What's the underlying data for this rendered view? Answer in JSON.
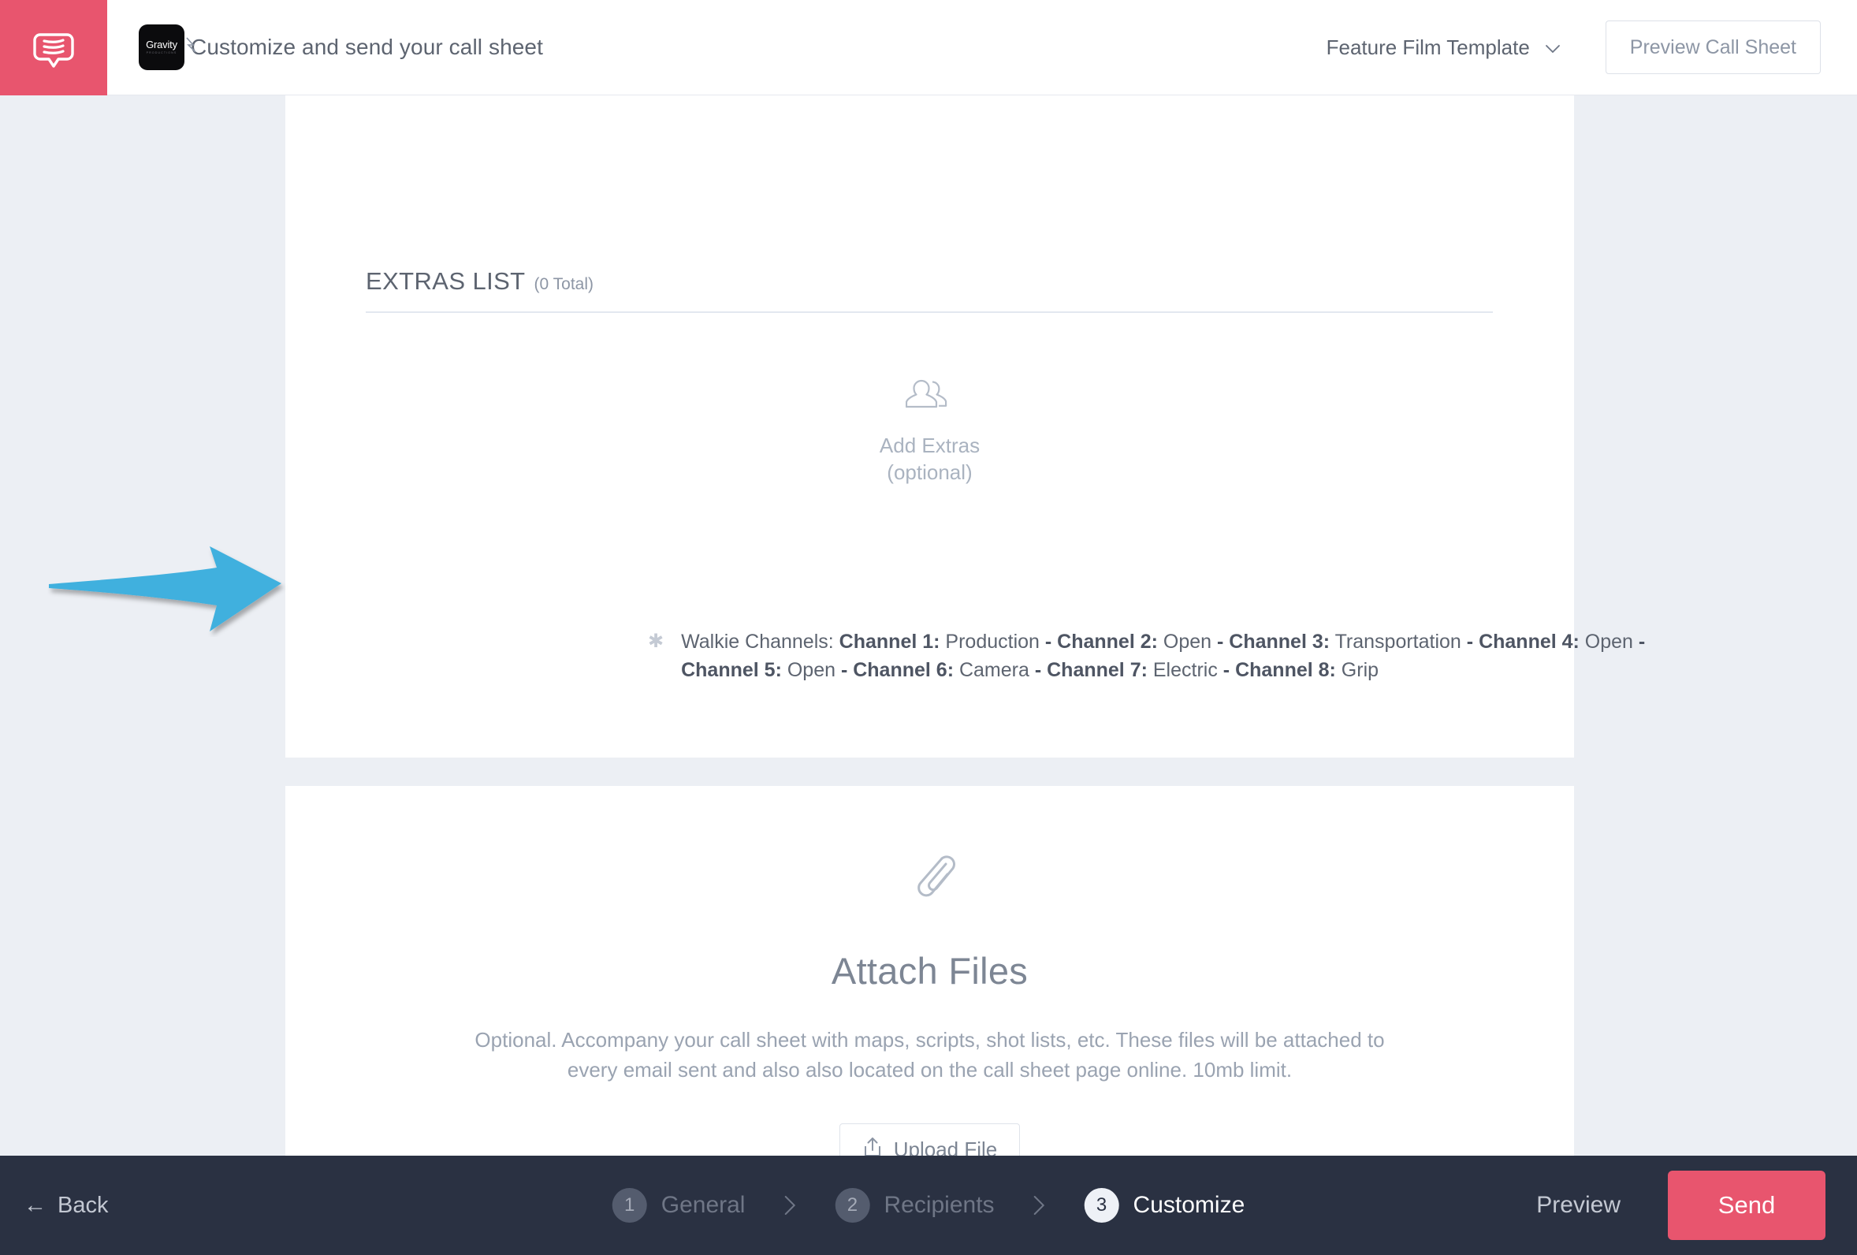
{
  "header": {
    "chat_icon": "chat-bubble-icon",
    "brand_word": "Gravity",
    "brand_sub": "PRODUCTIONS",
    "title": "Customize and send your call sheet",
    "template_label": "Feature Film Template",
    "template_chevron": "chevron-down-icon",
    "preview_call_sheet_label": "Preview Call Sheet"
  },
  "main": {
    "clipped_top_text": "(optional)",
    "extras": {
      "section_title": "EXTRAS LIST",
      "section_count": "(0 Total)",
      "empty_icon": "people-icon",
      "empty_line1": "Add Extras",
      "empty_line2": "(optional)"
    },
    "walkie": {
      "bullet_icon": "asterisk-icon",
      "label": "Walkie Channels:",
      "channels": [
        {
          "name": "Channel 1:",
          "value": "Production"
        },
        {
          "name": "Channel 2:",
          "value": "Open"
        },
        {
          "name": "Channel 3:",
          "value": "Transportation"
        },
        {
          "name": "Channel 4:",
          "value": "Open"
        },
        {
          "name": "Channel 5:",
          "value": "Open"
        },
        {
          "name": "Channel 6:",
          "value": "Camera "
        },
        {
          "name": "Channel 7:",
          "value": "Electric "
        },
        {
          "name": "Channel 8:",
          "value": "Grip"
        }
      ],
      "separator": "-"
    },
    "attach": {
      "icon": "paperclip-icon",
      "title": "Attach Files",
      "description": "Optional. Accompany your call sheet with maps, scripts, shot lists, etc. These files will be attached to every email sent and also also located on the call sheet page online. 10mb limit.",
      "upload_icon": "upload-icon",
      "upload_label": "Upload File"
    }
  },
  "annotation": {
    "arrow": "blue-arrow-pointing-right",
    "color": "#3fb0de"
  },
  "footer": {
    "back_arrow": "←",
    "back_label": "Back",
    "steps": [
      {
        "num": "1",
        "label": "General",
        "state": "done"
      },
      {
        "num": "2",
        "label": "Recipients",
        "state": "done"
      },
      {
        "num": "3",
        "label": "Customize",
        "state": "active"
      }
    ],
    "separator_icon": "chevron-right-icon",
    "preview_label": "Preview",
    "send_label": "Send",
    "send_color": "#e8556e"
  }
}
